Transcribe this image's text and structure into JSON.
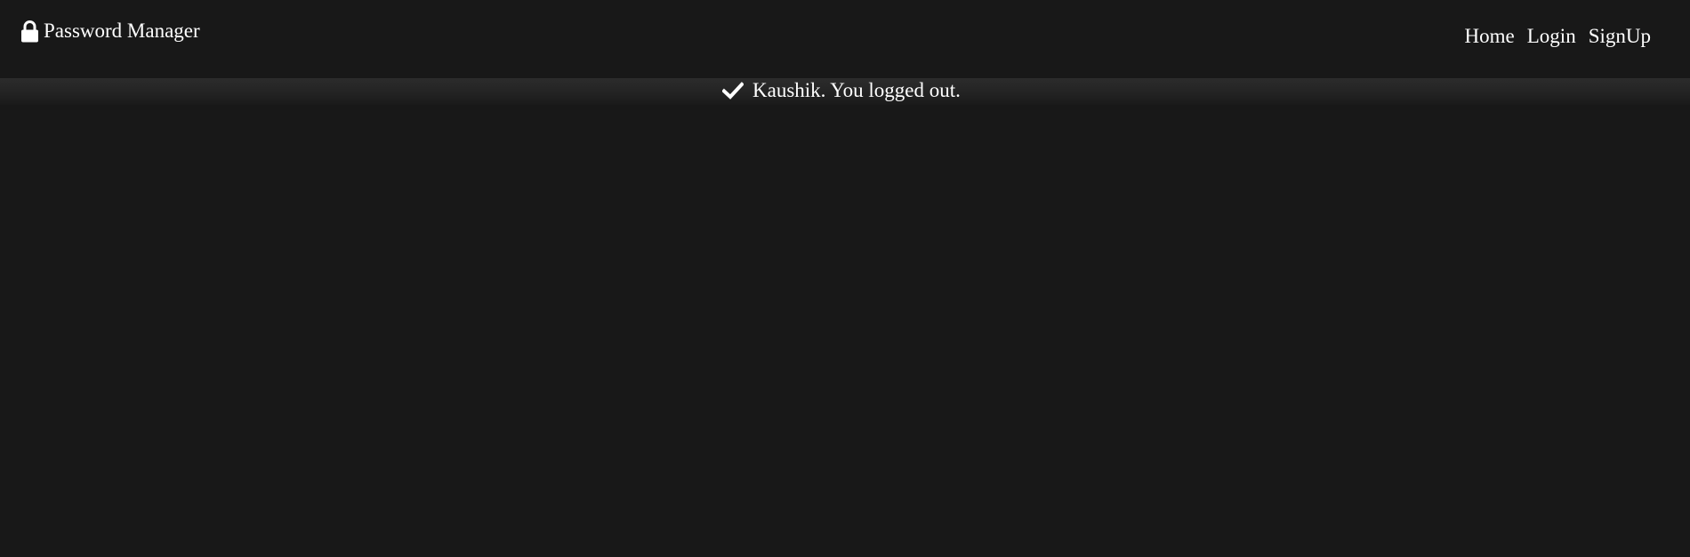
{
  "navbar": {
    "brand_icon": "lock-icon",
    "brand_label": "Password Manager",
    "links": [
      {
        "label": "Home"
      },
      {
        "label": "Login"
      },
      {
        "label": "SignUp"
      }
    ]
  },
  "flash": {
    "icon": "check-icon",
    "message": "Kaushik. You logged out."
  },
  "colors": {
    "background": "#181818",
    "text": "#ffffff"
  }
}
